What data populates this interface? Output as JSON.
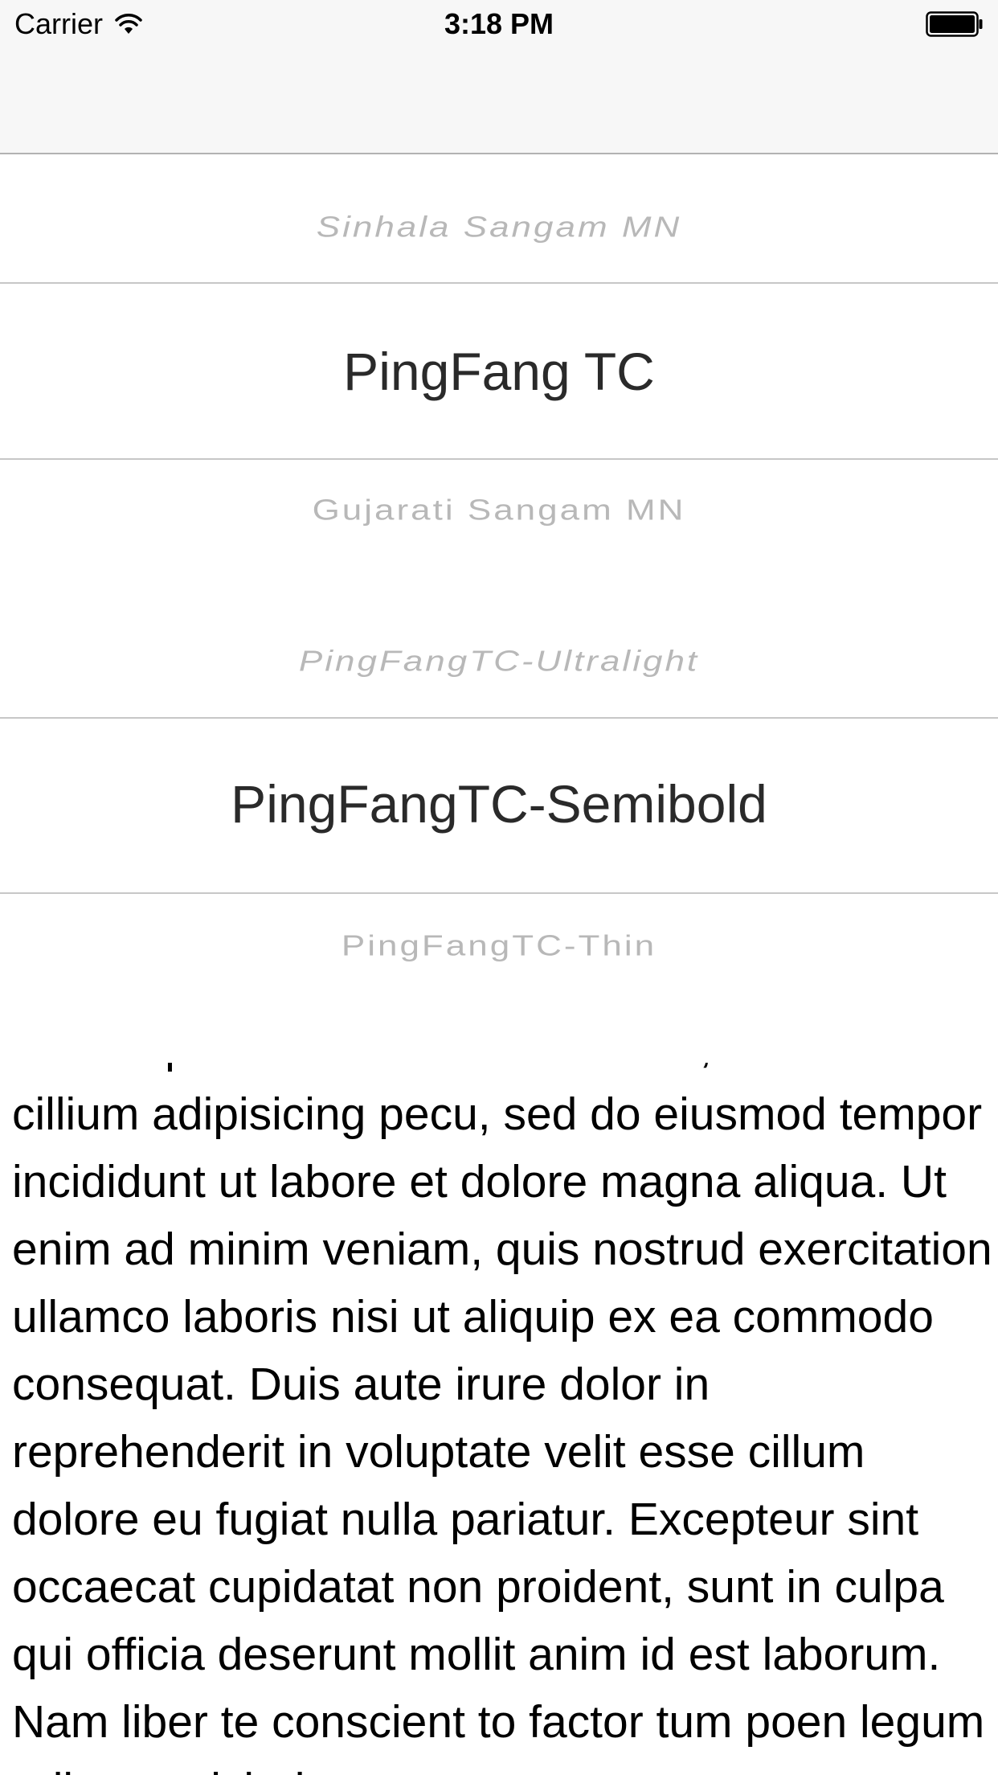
{
  "status_bar": {
    "carrier": "Carrier",
    "time": "3:18 PM",
    "wifi_icon": "wifi-icon",
    "battery_icon": "battery-icon"
  },
  "picker": {
    "items": [
      {
        "label": "Sinhala Sangam MN",
        "style": "dim"
      },
      {
        "label": "PingFang TC",
        "style": "selected-band"
      },
      {
        "label": "Gujarati Sangam MN",
        "style": "dim"
      },
      {
        "label": "PingFangTC-Ultralight",
        "style": "dim"
      },
      {
        "label": "PingFangTC-Semibold",
        "style": "selected-band"
      },
      {
        "label": "PingFangTC-Thin",
        "style": "dim"
      }
    ]
  },
  "text_view": {
    "text": "Lorem ipsum dolor sit er elit lamet, consectetaur cillium adipisicing pecu, sed do eiusmod tempor incididunt ut labore et dolore magna aliqua. Ut enim ad minim veniam, quis nostrud exercitation ullamco laboris nisi ut aliquip ex ea commodo consequat. Duis aute irure dolor in reprehenderit in voluptate velit esse cillum dolore eu fugiat nulla pariatur. Excepteur sint occaecat cupidatat non proident, sunt in culpa qui officia deserunt mollit anim id est laborum. Nam liber te conscient to factor tum poen legum odioque civiuda."
  }
}
